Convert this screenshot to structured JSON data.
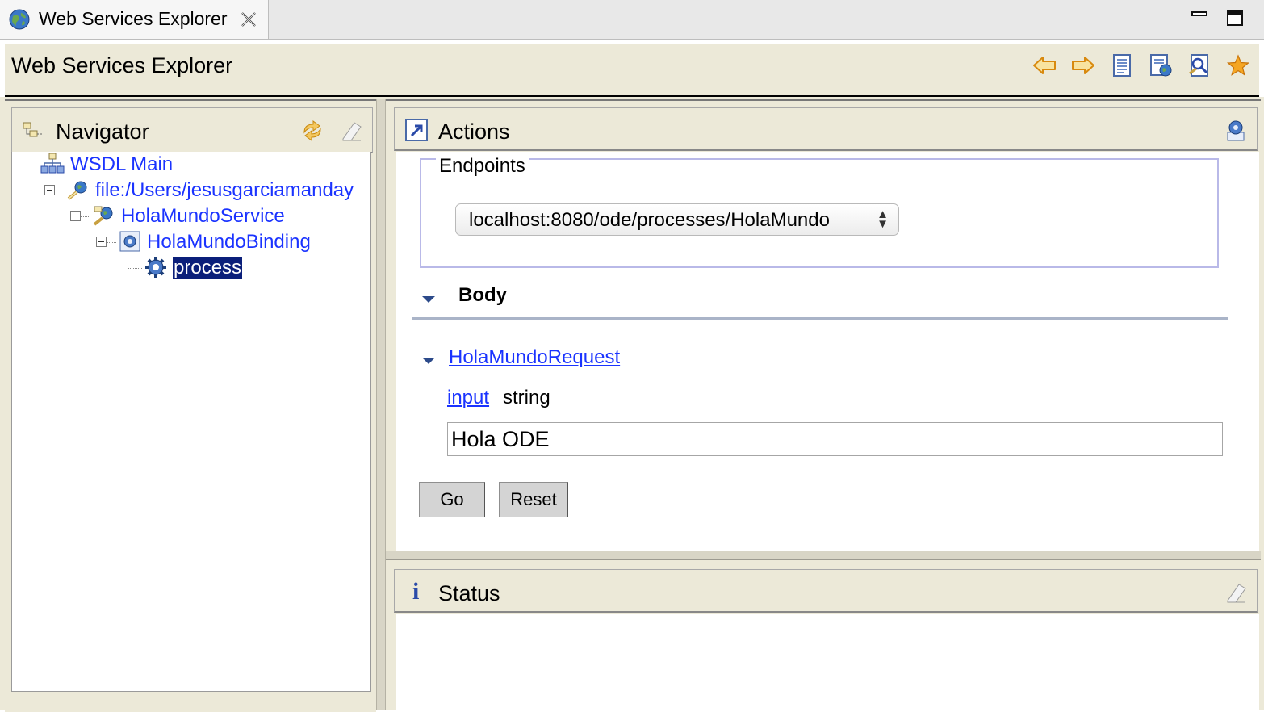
{
  "tab": {
    "title": "Web Services Explorer",
    "icon": "globe-icon",
    "close_icon": "close-icon"
  },
  "window_controls": {
    "minimize_icon": "minimize-icon",
    "maximize_icon": "maximize-icon"
  },
  "banner": {
    "title": "Web Services Explorer",
    "toolbar_icons": [
      "back-arrow-icon",
      "forward-arrow-icon",
      "uddi-page-icon",
      "wsil-page-icon",
      "wsdl-page-icon",
      "favorites-star-icon"
    ]
  },
  "navigator": {
    "title": "Navigator",
    "header_icons": [
      "refresh-icon",
      "eraser-icon"
    ],
    "tree": [
      {
        "label": "WSDL Main",
        "icon": "wsdl-main-icon",
        "level": 0
      },
      {
        "label": "file:/Users/jesusgarciamanday",
        "icon": "wsdl-file-icon",
        "level": 1
      },
      {
        "label": "HolaMundoService",
        "icon": "service-icon",
        "level": 2
      },
      {
        "label": "HolaMundoBinding",
        "icon": "binding-icon",
        "level": 3
      },
      {
        "label": "process",
        "icon": "operation-gear-icon",
        "level": 4,
        "selected": true
      }
    ]
  },
  "actions": {
    "title": "Actions",
    "header_icon": "actions-icon",
    "corner_icon": "source-view-icon",
    "endpoints": {
      "legend": "Endpoints",
      "selected": "localhost:8080/ode/processes/HolaMundo"
    },
    "body_section": "Body",
    "request_element": "HolaMundoRequest",
    "input_label": "input",
    "input_type": "string",
    "input_value": "Hola ODE",
    "buttons": {
      "go": "Go",
      "reset": "Reset"
    }
  },
  "status": {
    "title": "Status",
    "info_glyph": "i",
    "header_icon": "eraser-icon"
  },
  "colors": {
    "chrome_bg": "#ece9d8",
    "link_blue": "#1a33ff",
    "selection_bg": "#0b1f7a",
    "fieldset_border": "#b9b9e8"
  }
}
